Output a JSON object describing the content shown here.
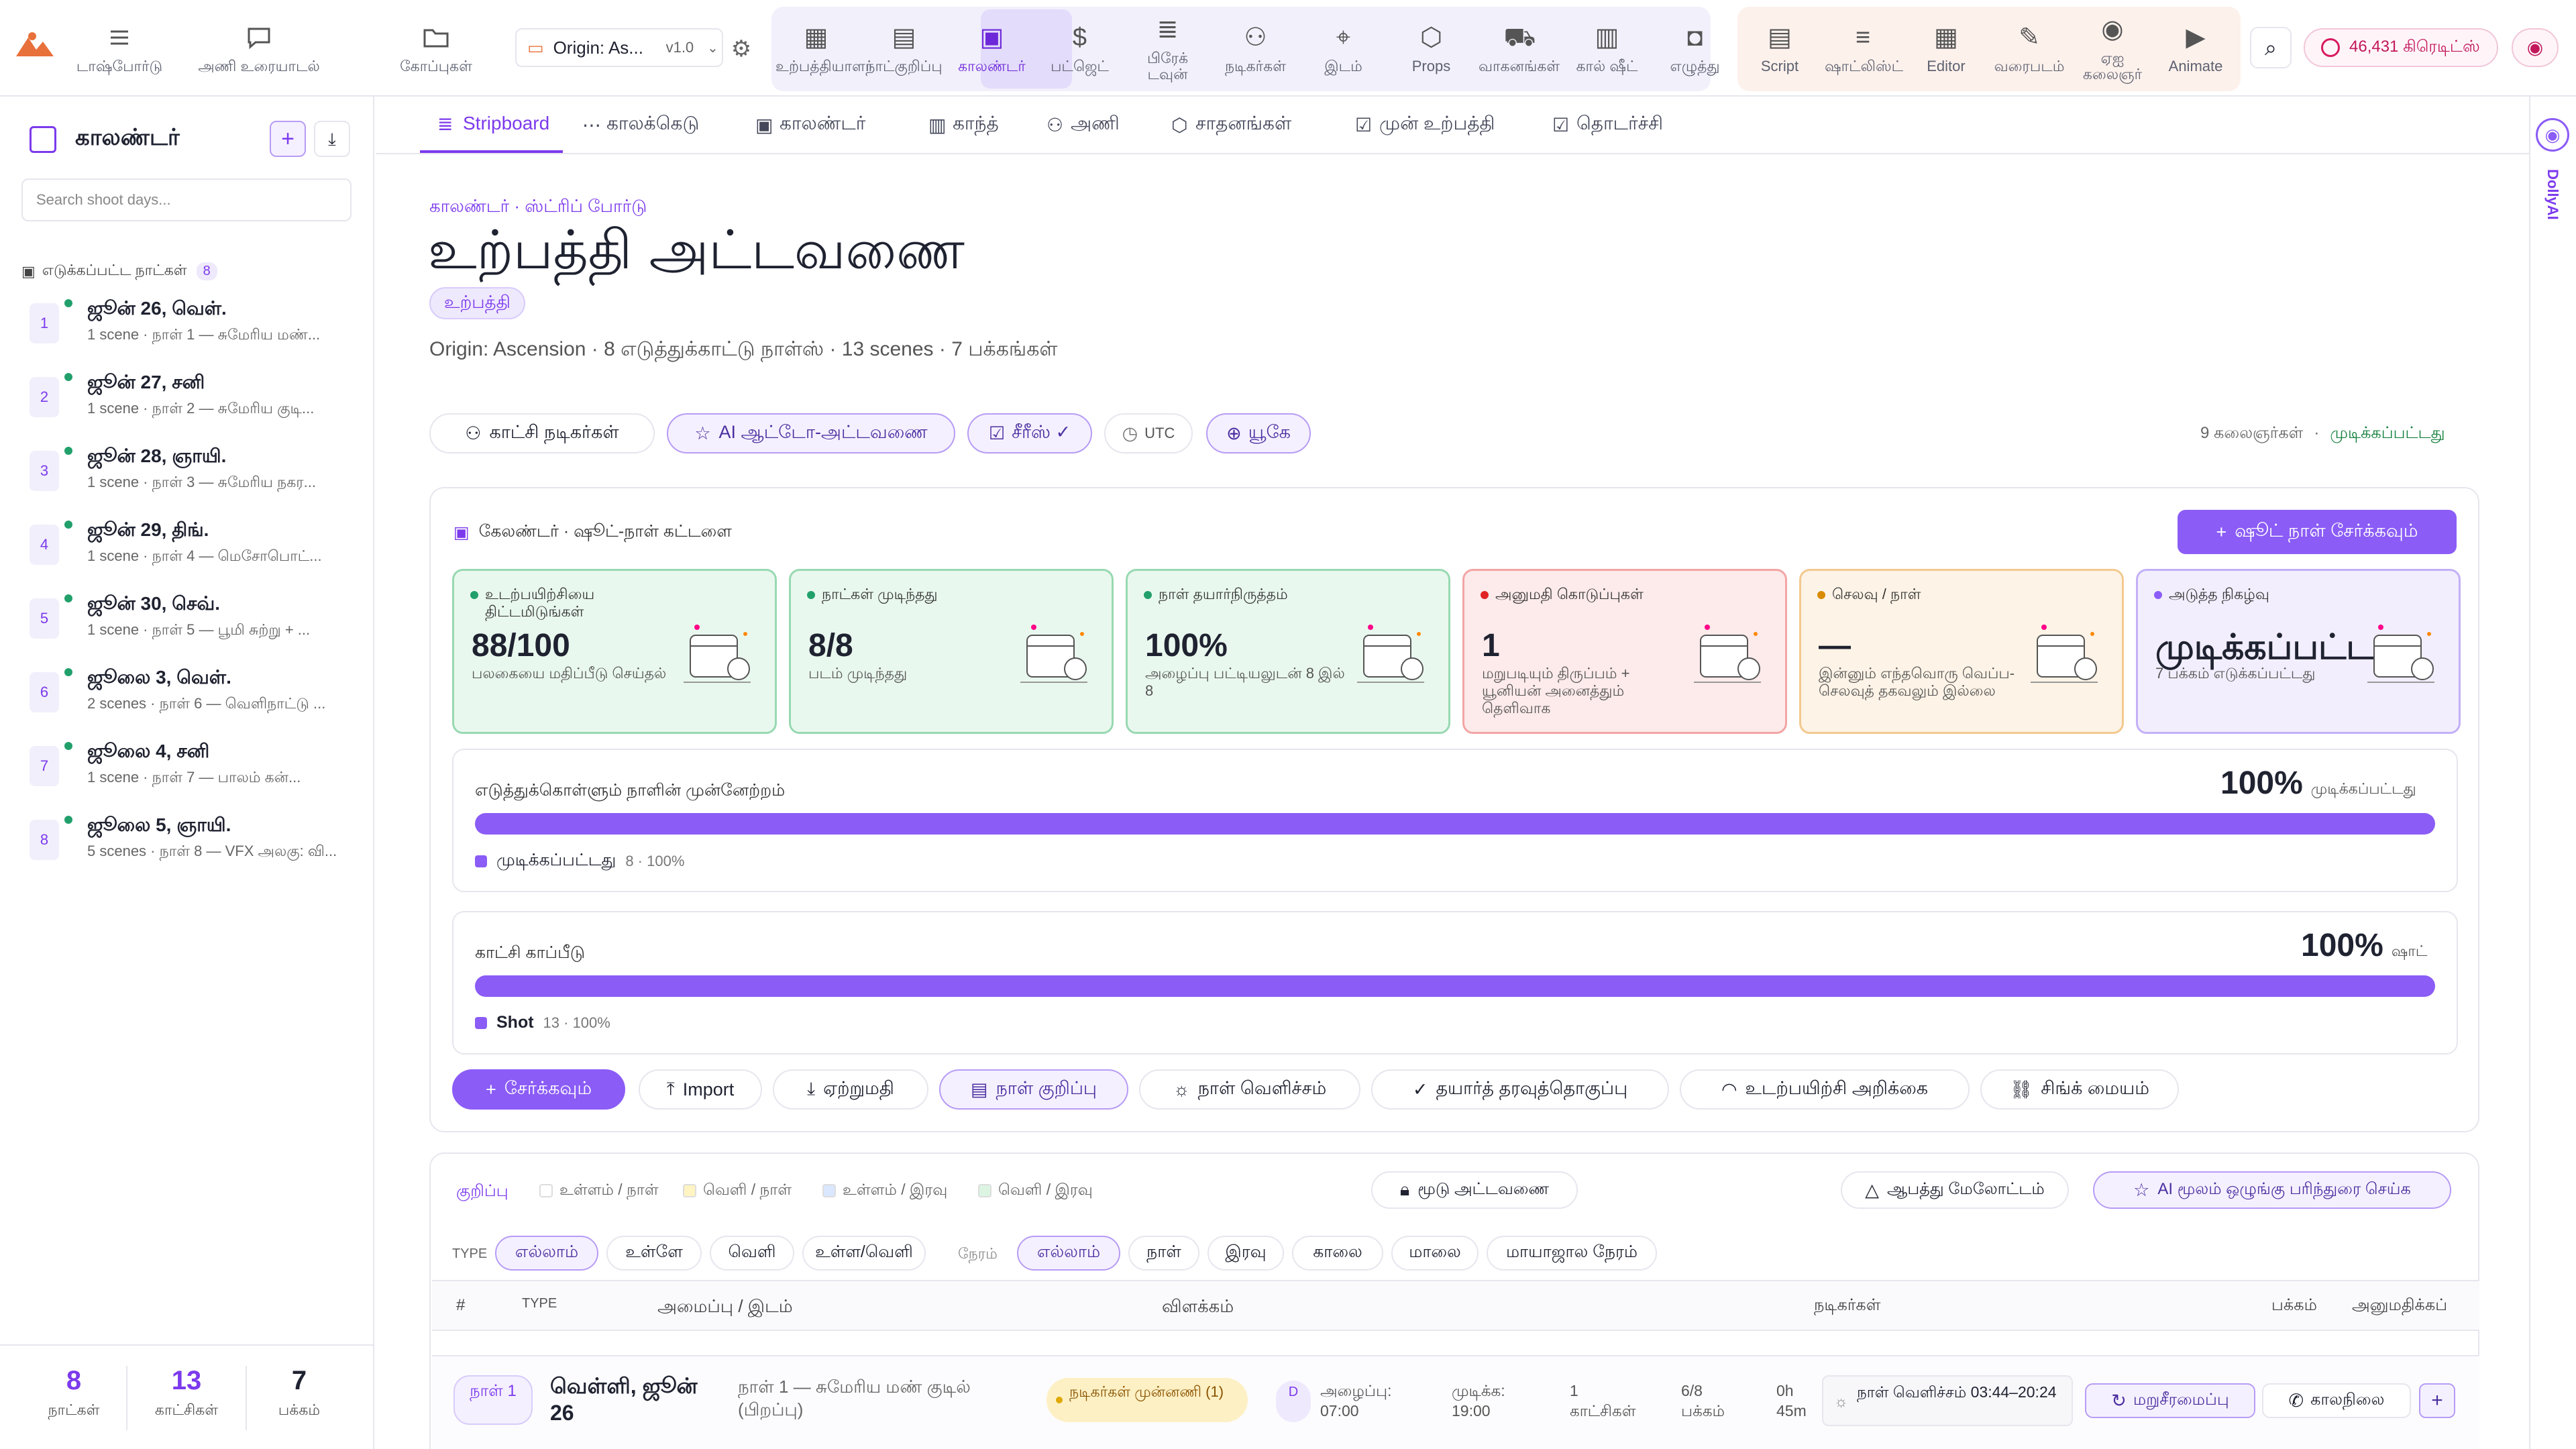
{
  "nav": {
    "items": [
      {
        "label": "டாஷ்போர்டு",
        "icon": "dashboard-icon"
      },
      {
        "label": "அணி உரையாடல்",
        "icon": "chat-icon"
      },
      {
        "label": "கோப்புகள்",
        "icon": "folder-icon"
      }
    ],
    "project": {
      "name": "Origin: As...",
      "version": "v1.0"
    },
    "purple_group": [
      {
        "label": "உற்பத்தியாளர்",
        "icon": "film-icon"
      },
      {
        "label": "நாட்குறிப்பு",
        "icon": "notebook-icon"
      },
      {
        "label": "காலண்டர்",
        "icon": "calendar-icon",
        "active": true
      },
      {
        "label": "பட்ஜெட்",
        "icon": "dollar-icon"
      },
      {
        "label": "பிரேக் டவுன்",
        "icon": "stack-icon"
      },
      {
        "label": "நடிகர்கள்",
        "icon": "people-icon"
      },
      {
        "label": "இடம்",
        "icon": "location-icon"
      },
      {
        "label": "Props",
        "icon": "cube-icon"
      },
      {
        "label": "வாகனங்கள்",
        "icon": "truck-icon"
      },
      {
        "label": "கால் ஷீட்",
        "icon": "callsheet-icon"
      },
      {
        "label": "எழுத்து",
        "icon": "camera-icon"
      }
    ],
    "orange_group": [
      {
        "label": "Script",
        "icon": "script-icon"
      },
      {
        "label": "ஷாட்லிஸ்ட்",
        "icon": "list-icon"
      },
      {
        "label": "Editor",
        "icon": "editor-icon"
      },
      {
        "label": "வரைபடம்",
        "icon": "pen-icon"
      },
      {
        "label": "ஏஐ கலைஞர்",
        "icon": "eye-icon"
      },
      {
        "label": "Animate",
        "icon": "play-icon"
      }
    ],
    "credits": "46,431 கிரெடிட்ஸ்"
  },
  "sidebar": {
    "title": "காலண்டர்",
    "search_placeholder": "Search shoot days...",
    "section_label": "எடுக்கப்பட்ட நாட்கள்",
    "section_count": "8",
    "days": [
      {
        "n": "1",
        "date": "ஜூன் 26, வெள்.",
        "sub": "1 scene · நாள் 1 — சுமேரிய மண்..."
      },
      {
        "n": "2",
        "date": "ஜூன் 27, சனி",
        "sub": "1 scene · நாள் 2 — சுமேரிய குடி..."
      },
      {
        "n": "3",
        "date": "ஜூன் 28, ஞாயி.",
        "sub": "1 scene · நாள் 3 — சுமேரிய நகர..."
      },
      {
        "n": "4",
        "date": "ஜூன் 29, திங்.",
        "sub": "1 scene · நாள் 4 — மெசோபொட்..."
      },
      {
        "n": "5",
        "date": "ஜூன் 30, செவ்.",
        "sub": "1 scene · நாள் 5 — பூமி சுற்று + ..."
      },
      {
        "n": "6",
        "date": "ஜூலை 3, வெள்.",
        "sub": "2 scenes · நாள் 6 — வெளிநாட்டு ..."
      },
      {
        "n": "7",
        "date": "ஜூலை 4, சனி",
        "sub": "1 scene · நாள் 7 — பாலம் கன்..."
      },
      {
        "n": "8",
        "date": "ஜூலை 5, ஞாயி.",
        "sub": "5 scenes · நாள் 8 — VFX அலகு: வி..."
      }
    ],
    "stats": [
      {
        "n": "8",
        "l": "நாட்கள்"
      },
      {
        "n": "13",
        "l": "காட்சிகள்"
      },
      {
        "n": "7",
        "l": "பக்கம்"
      }
    ]
  },
  "tabs": [
    "Stripboard",
    "காலக்கெடு",
    "காலண்டர்",
    "காந்த்",
    "அணி",
    "சாதனங்கள்",
    "முன் உற்பத்தி",
    "தொடர்ச்சி"
  ],
  "header": {
    "breadcrumb": "காலண்டர் · ஸ்ட்ரிப் போர்டு",
    "title": "உற்பத்தி அட்டவணை",
    "badge": "உற்பத்தி",
    "meta": "Origin: Ascension · 8 எடுத்துக்காட்டு நாள்ஸ் · 13 scenes · 7 பக்கங்கள்"
  },
  "actions": {
    "cast": "காட்சி நடிகர்கள்",
    "ai": "AI ஆட்டோ-அட்டவணை",
    "series": "சீரீஸ் ✓",
    "utc": "UTC",
    "uk": "யூகே",
    "artists": "9 கலைஞர்கள்",
    "status": "முடிக்கப்பட்டது"
  },
  "panel": {
    "title": "கேலண்டர் · ஷூட்-நாள் கட்டளை",
    "add_btn": "ஷூட் நாள் சேர்க்கவும்",
    "kpis": [
      {
        "title": "உடற்பயிற்சியை திட்டமிடுங்கள்",
        "value": "88/100",
        "sub": "பலகையை மதிப்பீடு செய்தல்",
        "tone": "green",
        "dot": "#22a06b"
      },
      {
        "title": "நாட்கள் முடிந்தது",
        "value": "8/8",
        "sub": "படம் முடிந்தது",
        "tone": "green",
        "dot": "#22a06b"
      },
      {
        "title": "நாள் தயார்நிருத்தம்",
        "value": "100%",
        "sub": "அழைப்பு பட்டியலுடன் 8 இல் 8",
        "tone": "green",
        "dot": "#22a06b"
      },
      {
        "title": "அனுமதி கொடுப்புகள்",
        "value": "1",
        "sub": "மறுபடியும் திருப்பம் + யூனியன் அனைத்தும் தெளிவாக",
        "tone": "red",
        "dot": "#e02424"
      },
      {
        "title": "செலவு / நாள்",
        "value": "—",
        "sub": "இன்னும் எந்தவொரு வெப்ப-செலவுத் தகவலும் இல்லை",
        "tone": "orange",
        "dot": "#d98b00"
      },
      {
        "title": "அடுத்த நிகழ்வு",
        "value": "முடிக்கப்பட்டது",
        "sub": "7 பக்கம் எடுக்கப்பட்டது",
        "tone": "purple",
        "dot": "#8b5cf6"
      }
    ],
    "progress1": {
      "label": "எடுத்துக்கொள்ளும் நாளின் முன்னேற்றம்",
      "pct": "100%",
      "pct_label": "முடிக்கப்பட்டது",
      "fill": 1.0,
      "legend": "முடிக்கப்பட்டது",
      "legend_sub": "8 · 100%"
    },
    "progress2": {
      "label": "காட்சி காப்பீடு",
      "pct": "100%",
      "pct_label": "ஷாட்",
      "fill": 1.0,
      "legend": "Shot",
      "legend_sub": "13 · 100%"
    },
    "buttons": [
      "சேர்க்கவும்",
      "Import",
      "ஏற்றுமதி",
      "நாள் குறிப்பு",
      "நாள் வெளிச்சம்",
      "தயார்த் தரவுத்தொகுப்பு",
      "உடற்பயிற்சி அறிக்கை",
      "சிங்க் மையம்"
    ]
  },
  "filters": {
    "legend_label": "குறிப்பு",
    "legend": [
      {
        "label": "உள்ளம் / நாள்",
        "color": "#ffffff"
      },
      {
        "label": "வெளி / நாள்",
        "color": "#fff4c2"
      },
      {
        "label": "உள்ளம் / இரவு",
        "color": "#dbe7ff"
      },
      {
        "label": "வெளி / இரவு",
        "color": "#dcf5e3"
      }
    ],
    "lock": "மூடு அட்டவணை",
    "risk": "ஆபத்து மேலோட்டம்",
    "ai_opt": "AI மூலம் ஒழுங்கு பரிந்துரை செய்க",
    "type_label": "TYPE",
    "type": [
      "எல்லாம்",
      "உள்ளே",
      "வெளி",
      "உள்ள/வெளி"
    ],
    "time_label": "நேரம்",
    "time": [
      "எல்லாம்",
      "நாள்",
      "இரவு",
      "காலை",
      "மாலை",
      "மாயாஜால நேரம்"
    ]
  },
  "table": {
    "headers": [
      "#",
      "TYPE",
      "அமைப்பு / இடம்",
      "விளக்கம்",
      "நடிகர்கள்",
      "பக்கம்",
      "அனுமதிக்கப்"
    ],
    "row": {
      "day": "நாள் 1",
      "date": "வெள்ளி, ஜூன் 26",
      "desc": "நாள் 1 — சுமேரிய மண் குடில் (பிறப்பு)",
      "cast_badge": "நடிகர்கள் முன்னணி (1)",
      "code": "D",
      "call": "அழைப்பு: 07:00",
      "wrap": "முடிக்க: 19:00",
      "scenes": "1 காட்சிகள்",
      "pages": "6/8 பக்கம்",
      "dur": "0h 45m",
      "light": "நாள் வெளிச்சம் 03:44–20:24",
      "reschedule": "மறுசீரமைப்பு",
      "weather": "காலநிலை"
    }
  },
  "right_rail": {
    "label": "DollyAI"
  }
}
